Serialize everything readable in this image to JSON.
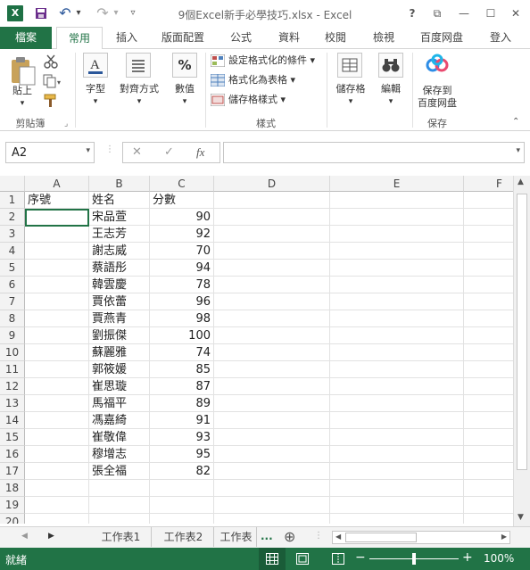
{
  "title_bar": {
    "title": "9個Excel新手必學技巧.xlsx - Excel",
    "logo_text": "X",
    "help": "?",
    "ribbon_display": "⧉",
    "minimize": "—",
    "maximize": "☐",
    "close": "✕"
  },
  "quick_access": {
    "save": "💾",
    "undo": "↶",
    "undo_dropdown": "▾",
    "redo": "↷",
    "redo_dropdown": "▾",
    "customize": "▿"
  },
  "tabs": [
    "檔案",
    "常用",
    "插入",
    "版面配置",
    "公式",
    "資料",
    "校閱",
    "檢視",
    "百度网盘",
    "登入"
  ],
  "ribbon": {
    "clipboard": {
      "paste": "貼上",
      "group": "剪貼簿"
    },
    "font": {
      "label": "字型"
    },
    "alignment": {
      "label": "對齊方式"
    },
    "number": {
      "label": "數值",
      "symbol": "%"
    },
    "styles": {
      "conditional": "設定格式化的條件",
      "table": "格式化為表格",
      "cell_styles": "儲存格樣式",
      "group": "樣式"
    },
    "cells": {
      "label": "儲存格"
    },
    "editing": {
      "label": "編輯"
    },
    "baidu": {
      "label1": "保存到",
      "label2": "百度网盘",
      "group": "保存"
    }
  },
  "formula_bar": {
    "name_box": "A2",
    "cancel": "✕",
    "enter": "✓",
    "fx": "fx",
    "value": ""
  },
  "columns": [
    "A",
    "B",
    "C",
    "D",
    "E",
    "F"
  ],
  "rows": [
    {
      "n": "1",
      "a": "序號",
      "b": "姓名",
      "c": "分數"
    },
    {
      "n": "2",
      "a": "",
      "b": "宋品萱",
      "c": "90"
    },
    {
      "n": "3",
      "a": "",
      "b": "王志芳",
      "c": "92"
    },
    {
      "n": "4",
      "a": "",
      "b": "謝志威",
      "c": "70"
    },
    {
      "n": "5",
      "a": "",
      "b": "蔡語彤",
      "c": "94"
    },
    {
      "n": "6",
      "a": "",
      "b": "韓雲慶",
      "c": "78"
    },
    {
      "n": "7",
      "a": "",
      "b": "賈依蕾",
      "c": "96"
    },
    {
      "n": "8",
      "a": "",
      "b": "賈燕青",
      "c": "98"
    },
    {
      "n": "9",
      "a": "",
      "b": "劉振傑",
      "c": "100"
    },
    {
      "n": "10",
      "a": "",
      "b": "蘇麗雅",
      "c": "74"
    },
    {
      "n": "11",
      "a": "",
      "b": "郭筱媛",
      "c": "85"
    },
    {
      "n": "12",
      "a": "",
      "b": "崔思璇",
      "c": "87"
    },
    {
      "n": "13",
      "a": "",
      "b": "馬福平",
      "c": "89"
    },
    {
      "n": "14",
      "a": "",
      "b": "馮嘉綺",
      "c": "91"
    },
    {
      "n": "15",
      "a": "",
      "b": "崔敬偉",
      "c": "93"
    },
    {
      "n": "16",
      "a": "",
      "b": "穆增志",
      "c": "95"
    },
    {
      "n": "17",
      "a": "",
      "b": "張全福",
      "c": "82"
    },
    {
      "n": "18",
      "a": "",
      "b": "",
      "c": ""
    },
    {
      "n": "19",
      "a": "",
      "b": "",
      "c": ""
    },
    {
      "n": "20",
      "a": "",
      "b": "",
      "c": ""
    }
  ],
  "sheets": {
    "tabs": [
      "工作表1",
      "工作表2",
      "工作表"
    ],
    "more": "...",
    "add": "⊕"
  },
  "status": {
    "ready": "就緒",
    "zoom": "100%",
    "zoom_minus": "−",
    "zoom_plus": "+"
  },
  "colors": {
    "brand": "#217346",
    "header_bg": "#f3f3f3"
  }
}
